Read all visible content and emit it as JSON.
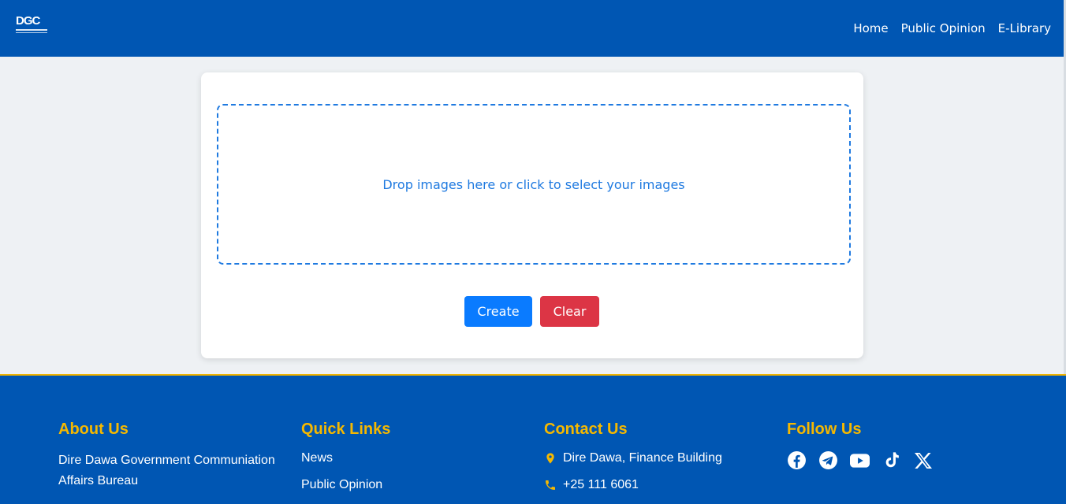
{
  "header": {
    "logo_text": "DGC",
    "nav": [
      "Home",
      "Public Opinion",
      "E-Library"
    ]
  },
  "upload": {
    "dropzone_text": "Drop images here or click to select your images",
    "create_label": "Create",
    "clear_label": "Clear"
  },
  "footer": {
    "about": {
      "title": "About Us",
      "text": "Dire Dawa Government Communiation Affairs Bureau"
    },
    "quick_links": {
      "title": "Quick Links",
      "items": [
        "News",
        "Public Opinion"
      ]
    },
    "contact": {
      "title": "Contact Us",
      "address": "Dire Dawa, Finance Building",
      "phone": "+25 111 6061"
    },
    "follow": {
      "title": "Follow Us",
      "icons": [
        "facebook-icon",
        "telegram-icon",
        "youtube-icon",
        "tiktok-icon",
        "x-icon"
      ]
    }
  },
  "colors": {
    "primary": "#0056b3",
    "accent": "#f5b800",
    "create": "#0a7bff",
    "clear": "#dc3545"
  }
}
